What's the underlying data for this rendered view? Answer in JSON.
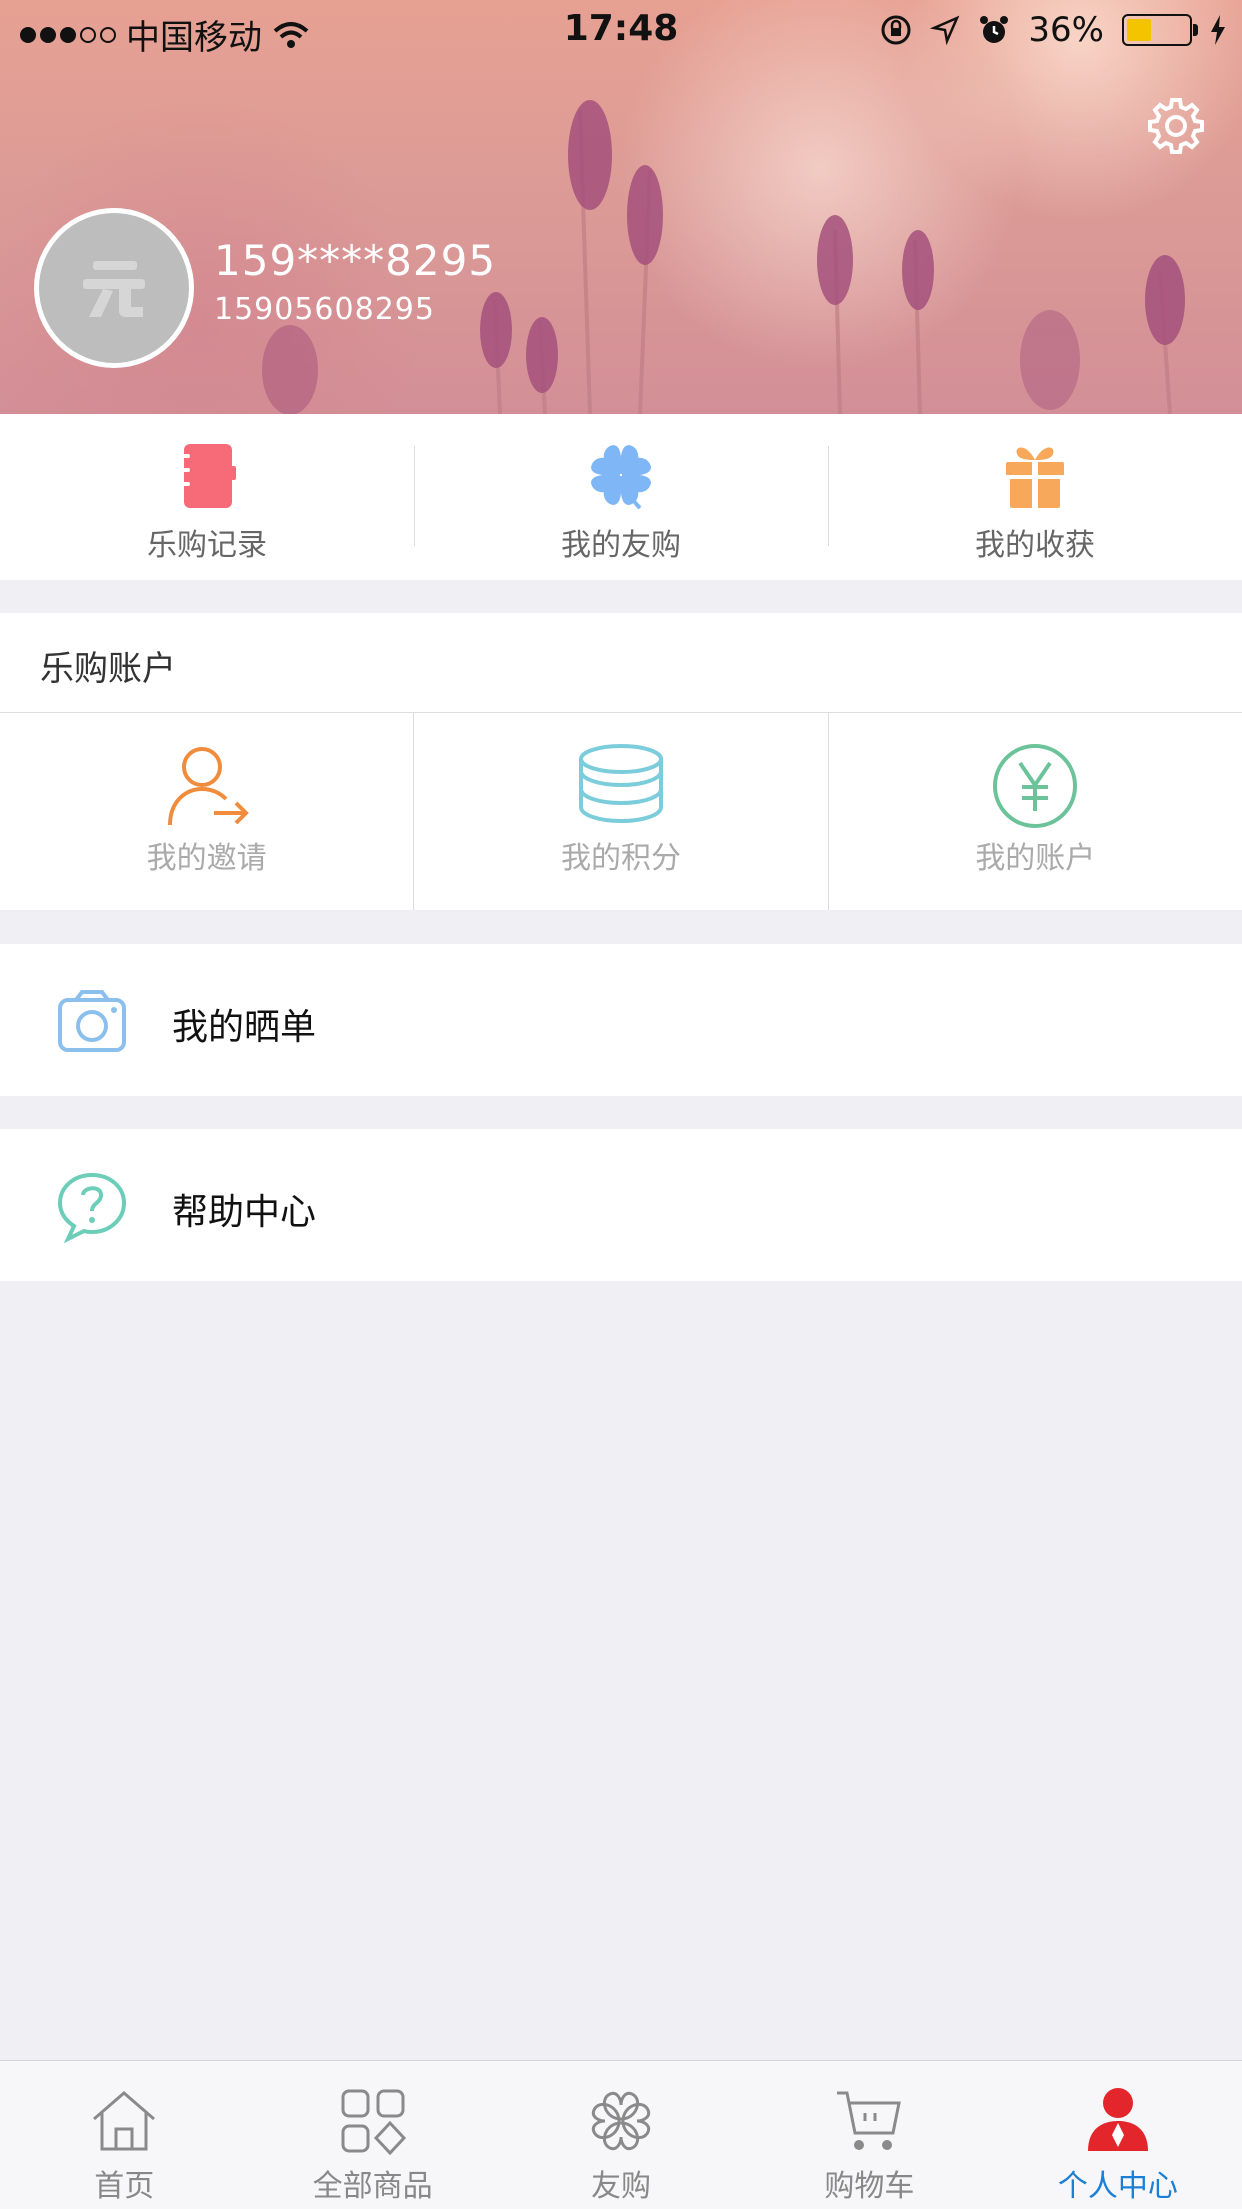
{
  "status_bar": {
    "carrier": "中国移动",
    "time": "17:48",
    "battery": "36%",
    "battery_level": 0.36
  },
  "profile": {
    "nickname": "159****8295",
    "phone": "15905608295"
  },
  "quick_actions": [
    {
      "label": "乐购记录",
      "icon": "notebook-icon",
      "color": "#f76b78"
    },
    {
      "label": "我的友购",
      "icon": "clover-icon",
      "color": "#7fb6f5"
    },
    {
      "label": "我的收获",
      "icon": "gift-icon",
      "color": "#f8a85a"
    }
  ],
  "account": {
    "title": "乐购账户",
    "items": [
      {
        "label": "我的邀请",
        "icon": "invite-user-icon",
        "color": "#f08c3c"
      },
      {
        "label": "我的积分",
        "icon": "coins-stack-icon",
        "color": "#7ccddc"
      },
      {
        "label": "我的账户",
        "icon": "yuan-coin-icon",
        "color": "#6cc39a"
      }
    ]
  },
  "menu": [
    {
      "label": "我的晒单",
      "icon": "camera-icon",
      "color": "#8cc0ec"
    },
    {
      "label": "帮助中心",
      "icon": "help-chat-icon",
      "color": "#6ccdb8"
    }
  ],
  "tabs": [
    {
      "label": "首页",
      "icon": "home-icon"
    },
    {
      "label": "全部商品",
      "icon": "grid-icon"
    },
    {
      "label": "友购",
      "icon": "clover-icon"
    },
    {
      "label": "购物车",
      "icon": "cart-icon"
    },
    {
      "label": "个人中心",
      "icon": "person-icon",
      "active": true
    }
  ],
  "colors": {
    "accent": "#1a7fd6",
    "active_tab_icon": "#e3262c",
    "background": "#efeff4"
  }
}
